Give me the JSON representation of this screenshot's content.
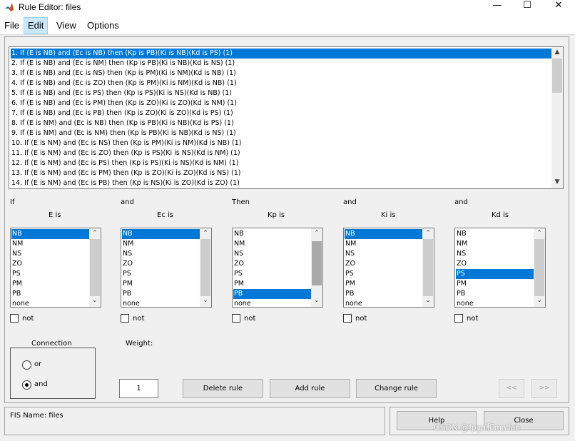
{
  "window": {
    "title": "Rule Editor: files",
    "minimize": "—",
    "maximize": "☐",
    "close": "✕"
  },
  "menu": {
    "items": [
      "File",
      "Edit",
      "View",
      "Options"
    ],
    "active": "Edit"
  },
  "rules": [
    "1. If (E is NB) and (Ec is NB) then (Kp is PB)(Ki is NB)(Kd is PS) (1)",
    "2. If (E is NB) and (Ec is NM) then (Kp is PB)(Ki is NB)(Kd is NS) (1)",
    "3. If (E is NB) and (Ec is NS) then (Kp is PM)(Ki is NM)(Kd is NB) (1)",
    "4. If (E is NB) and (Ec is ZO) then (Kp is PM)(Ki is NM)(Kd is NB) (1)",
    "5. If (E is NB) and (Ec is PS) then (Kp is PS)(Ki is NS)(Kd is NB) (1)",
    "6. If (E is NB) and (Ec is PM) then (Kp is ZO)(Ki is ZO)(Kd is NM) (1)",
    "7. If (E is NB) and (Ec is PB) then (Kp is ZO)(Ki is ZO)(Kd is PS) (1)",
    "8. If (E is NM) and (Ec is NB) then (Kp is PB)(Ki is NB)(Kd is PS) (1)",
    "9. If (E is NM) and (Ec is NM) then (Kp is PB)(Ki is NB)(Kd is NS) (1)",
    "10. If (E is NM) and (Ec is NS) then (Kp is PM)(Ki is NM)(Kd is NB) (1)",
    "11. If (E is NM) and (Ec is ZO) then (Kp is PS)(Ki is NS)(Kd is NM) (1)",
    "12. If (E is NM) and (Ec is PS) then (Kp is PS)(Ki is NS)(Kd is NM) (1)",
    "13. If (E is NM) and (Ec is PM) then (Kp is ZO)(Ki is ZO)(Kd is NS) (1)",
    "14. If (E is NM) and (Ec is PB) then (Kp is NS)(Ki is ZO)(Kd is ZO) (1)"
  ],
  "selected_rule_index": 0,
  "columns": [
    {
      "prefix": "If",
      "name": "E is",
      "selected": "NB",
      "not_label": "not"
    },
    {
      "prefix": "and",
      "name": "Ec is",
      "selected": "NB",
      "not_label": "not"
    },
    {
      "prefix": "Then",
      "name": "Kp is",
      "selected": "PB",
      "not_label": "not"
    },
    {
      "prefix": "and",
      "name": "Ki is",
      "selected": "NB",
      "not_label": "not"
    },
    {
      "prefix": "and",
      "name": "Kd is",
      "selected": "PS",
      "not_label": "not"
    }
  ],
  "mf_options": [
    "NB",
    "NM",
    "NS",
    "ZO",
    "PS",
    "PM",
    "PB",
    "none"
  ],
  "connection": {
    "title": "Connection",
    "options": [
      "or",
      "and"
    ],
    "selected": "and"
  },
  "weight": {
    "label": "Weight:",
    "value": "1"
  },
  "buttons": {
    "delete": "Delete rule",
    "add": "Add rule",
    "change": "Change rule",
    "prev": "<<",
    "next": ">>",
    "help": "Help",
    "close": "Close"
  },
  "status": {
    "fis_name": "FIS Name: files"
  },
  "watermark": "CSDN @fpga和matlab"
}
